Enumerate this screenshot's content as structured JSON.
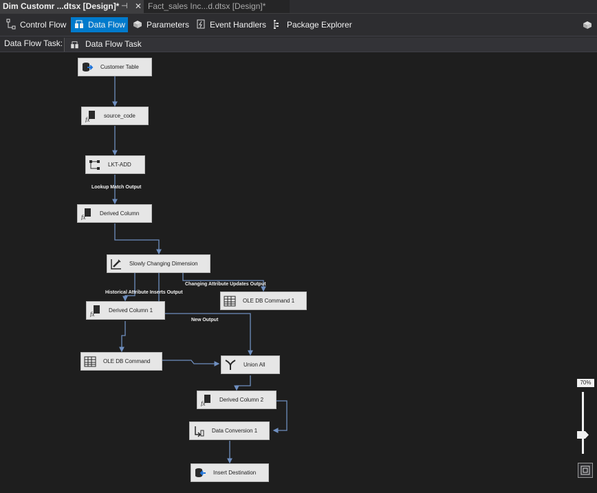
{
  "tabs": [
    {
      "label": "Dim Customr ...dtsx [Design]*"
    },
    {
      "label": "Fact_sales Inc...d.dtsx [Design]*"
    }
  ],
  "tab_pin_glyph": "⊣",
  "tab_close_glyph": "✕",
  "toolbar": {
    "control_flow": "Control Flow",
    "data_flow": "Data Flow",
    "parameters": "Parameters",
    "event_handlers": "Event Handlers",
    "package_explorer": "Package Explorer"
  },
  "task_bar": {
    "label": "Data Flow Task:",
    "selected": "Data Flow Task"
  },
  "nodes": {
    "customer_table": "Customer Table",
    "source_code": "source_code",
    "lkt_add": "LKT-ADD",
    "derived_column": "Derived Column",
    "scd": "Slowly Changing Dimension",
    "ole_db_command_1": "OLE DB Command 1",
    "derived_column_1": "Derived Column 1",
    "ole_db_command": "OLE DB Command",
    "union_all": "Union All",
    "derived_column_2": "Derived Column 2",
    "data_conversion_1": "Data Conversion 1",
    "insert_destination": "Insert Destination"
  },
  "path_labels": {
    "lookup_match": "Lookup Match Output",
    "changing_attr": "Changing Attribute Updates Output",
    "historical_attr": "Historical Attribute Inserts Output",
    "new_output": "New Output"
  },
  "zoom": {
    "label": "70%",
    "level_percent": 70
  },
  "colors": {
    "accent": "#007acc",
    "canvas": "#1e1e1e",
    "node_fill": "#e6e6e6",
    "connector": "#6f8fc0"
  }
}
